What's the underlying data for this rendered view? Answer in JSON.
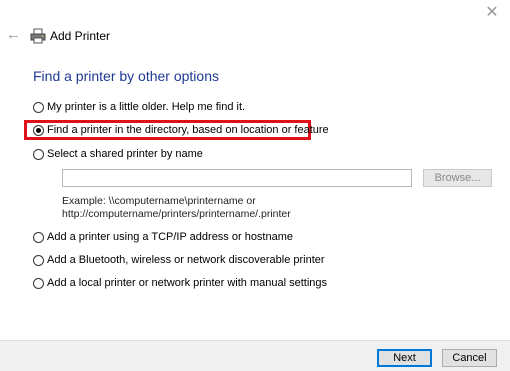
{
  "window": {
    "title": "Add Printer",
    "close_glyph": "✕",
    "back_glyph": "←"
  },
  "heading": "Find a printer by other options",
  "options": [
    {
      "label": "My printer is a little older. Help me find it.",
      "checked": false
    },
    {
      "label": "Find a printer in the directory, based on location or feature",
      "checked": true
    },
    {
      "label": "Select a shared printer by name",
      "checked": false
    },
    {
      "label": "Add a printer using a TCP/IP address or hostname",
      "checked": false
    },
    {
      "label": "Add a Bluetooth, wireless or network discoverable printer",
      "checked": false
    },
    {
      "label": "Add a local printer or network printer with manual settings",
      "checked": false
    }
  ],
  "shared_printer": {
    "value": "",
    "browse_label": "Browse...",
    "example_line1": "Example: \\\\computername\\printername or",
    "example_line2": "http://computername/printers/printername/.printer"
  },
  "footer": {
    "next_label": "Next",
    "cancel_label": "Cancel"
  },
  "colors": {
    "heading": "#1f3a93",
    "highlight": "#e0101b",
    "accent": "#0078d7"
  },
  "icons": [
    "close-icon",
    "back-arrow-icon",
    "printer-icon"
  ]
}
